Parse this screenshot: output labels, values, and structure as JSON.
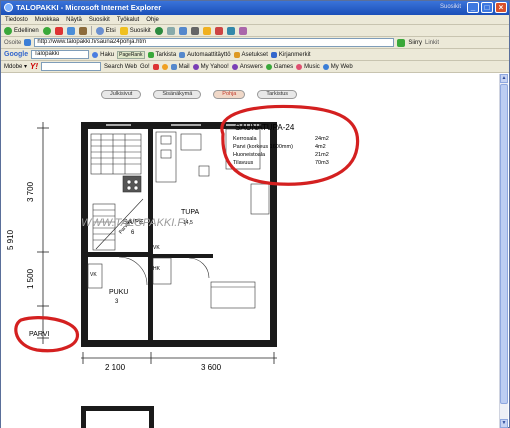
{
  "window": {
    "title": "TALOPAKKI - Microsoft Internet Explorer",
    "title_right": "Suosikit"
  },
  "menu": [
    "Tiedosto",
    "Muokkaa",
    "Näytä",
    "Suosikit",
    "Työkalut",
    "Ohje"
  ],
  "toolbar": {
    "back_label": "Edellinen",
    "search_label": "Etsi",
    "favorites_label": "Suosikit"
  },
  "address": {
    "label": "Osoite",
    "url": "http://www.talopakki.fi/sauna24pohja.htm",
    "go_label": "Siirry",
    "links_label": "Linkit"
  },
  "google": {
    "brand": "Google",
    "query": "Talopakki",
    "search_label": "Haku",
    "pagerank_label": "PageRank",
    "check_label": "Tarkista",
    "autolink_label": "Automaattitäyttö",
    "options_label": "Asetukset",
    "bookmarks_label": "Kirjanmerkit"
  },
  "yahoo": {
    "brand": "Y!",
    "search_web": "Search Web",
    "go_label": "Go!",
    "mail_label": "Mail",
    "my_yahoo": "My Yahoo!",
    "answers": "Answers",
    "games": "Games",
    "music": "Music",
    "my_web": "My Web"
  },
  "tabs": [
    "Julkisivut",
    "Sisänäkymä",
    "Pohja",
    "Tarkistus"
  ],
  "active_tab_index": 2,
  "plan": {
    "watermark": "WWW.TALOPAKKI.FI",
    "info": {
      "title": "SAUNATUPA-24",
      "rows": [
        {
          "label": "Kerrosala",
          "value": "24m2"
        },
        {
          "label": "Parvi (korkeus 1600mm)",
          "value": "4m2"
        },
        {
          "label": "Huoneistoala",
          "value": "21m2"
        },
        {
          "label": "Tilavuus",
          "value": "70m3"
        }
      ]
    },
    "rooms": {
      "tupa": "TUPA",
      "tupa_area": "14,5",
      "sape": "SA/PE",
      "sape_area": "6",
      "puku": "PUKU",
      "puku_area": "3",
      "parvi": "PARVI",
      "vk1": "VK",
      "vk2": "VK",
      "hk": "HK",
      "stair_label": "Parvelle"
    },
    "dims": {
      "left_total": "5 910",
      "left_upper": "3 700",
      "left_lower": "1 500",
      "bottom_left": "2 100",
      "bottom_right": "3 600"
    }
  },
  "colors": {
    "annotation_red": "#d42020",
    "titlebar_blue": "#2459c4"
  }
}
